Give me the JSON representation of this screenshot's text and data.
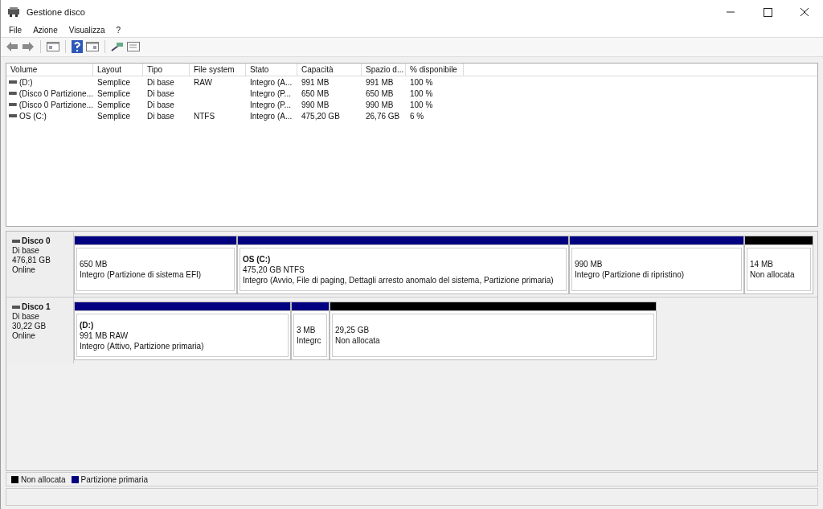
{
  "window": {
    "title": "Gestione disco"
  },
  "menu": [
    "File",
    "Azione",
    "Visualizza",
    "?"
  ],
  "table": {
    "columns": [
      "Volume",
      "Layout",
      "Tipo",
      "File system",
      "Stato",
      "Capacità",
      "Spazio d...",
      "% disponibile"
    ],
    "rows": [
      [
        "(D:)",
        "Semplice",
        "Di base",
        "RAW",
        "Integro (A...",
        "991 MB",
        "991 MB",
        "100 %"
      ],
      [
        "(Disco 0 Partizione...",
        "Semplice",
        "Di base",
        "",
        "Integro (P...",
        "650 MB",
        "650 MB",
        "100 %"
      ],
      [
        "(Disco 0 Partizione...",
        "Semplice",
        "Di base",
        "",
        "Integro (P...",
        "990 MB",
        "990 MB",
        "100 %"
      ],
      [
        "OS (C:)",
        "Semplice",
        "Di base",
        "NTFS",
        "Integro (A...",
        "475,20 GB",
        "26,76 GB",
        "6 %"
      ]
    ]
  },
  "disks": [
    {
      "name": "Disco 0",
      "type": "Di base",
      "size": "476,81 GB",
      "status": "Online",
      "partitions": [
        {
          "kind": "primary",
          "size": "650 MB",
          "status": "Integro (Partizione di sistema EFI)"
        },
        {
          "kind": "primary",
          "label": "OS  (C:)",
          "size": "475,20 GB NTFS",
          "status": "Integro (Avvio, File di paging, Dettagli arresto anomalo del sistema, Partizione primaria)"
        },
        {
          "kind": "primary",
          "size": "990 MB",
          "status": "Integro (Partizione di ripristino)"
        },
        {
          "kind": "unallocated",
          "size": "14 MB",
          "status": "Non allocata"
        }
      ]
    },
    {
      "name": "Disco 1",
      "type": "Di base",
      "size": "30,22 GB",
      "status": "Online",
      "partitions": [
        {
          "kind": "primary",
          "label": "(D:)",
          "size": "991 MB RAW",
          "status": "Integro (Attivo, Partizione primaria)"
        },
        {
          "kind": "primary",
          "size": "3 MB",
          "status": "Integrc"
        },
        {
          "kind": "unallocated",
          "size": "29,25 GB",
          "status": "Non allocata"
        }
      ]
    }
  ],
  "legend": [
    {
      "label": "Non allocata",
      "color": "#000000"
    },
    {
      "label": "Partizione primaria",
      "color": "#000080"
    }
  ]
}
